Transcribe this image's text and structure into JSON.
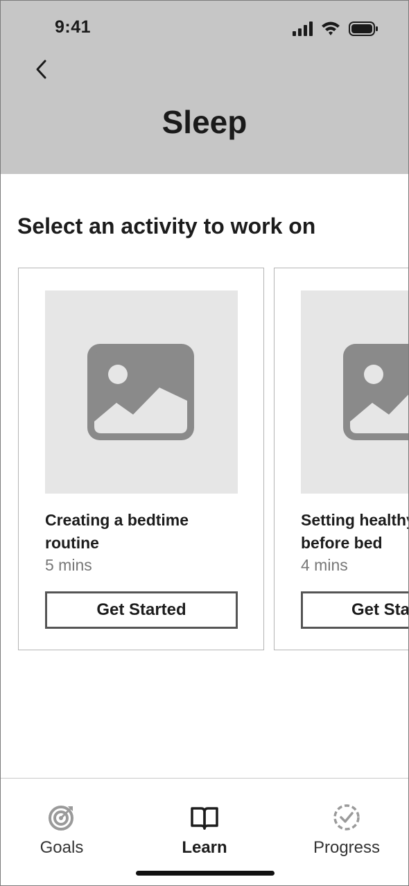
{
  "status_bar": {
    "time": "9:41",
    "icons": [
      "signal-icon",
      "wifi-icon",
      "battery-icon"
    ]
  },
  "header": {
    "back_icon": "chevron-left-icon",
    "title": "Sleep"
  },
  "section": {
    "heading": "Select an activity to work on"
  },
  "activities": [
    {
      "title_line1": "Creating a bedtime",
      "title_line2": "routine",
      "duration": "5 mins",
      "button_label": "Get Started",
      "image_icon": "image-placeholder-icon"
    },
    {
      "title_line1": "Setting healthy habits",
      "title_line2": "before bed",
      "duration": "4 mins",
      "button_label": "Get Started",
      "image_icon": "image-placeholder-icon"
    }
  ],
  "bottom_nav": {
    "items": [
      {
        "label": "Goals",
        "icon": "target-icon",
        "active": false
      },
      {
        "label": "Learn",
        "icon": "book-icon",
        "active": true
      },
      {
        "label": "Progress",
        "icon": "progress-check-icon",
        "active": false
      }
    ]
  },
  "colors": {
    "header_bg": "#c6c6c6",
    "image_bg": "#e6e6e6",
    "image_icon": "#8a8a8a",
    "text": "#1c1c1c",
    "muted_text": "#777777"
  }
}
